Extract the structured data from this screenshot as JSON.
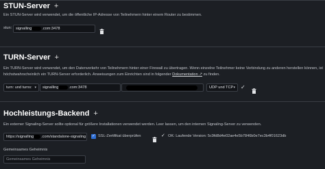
{
  "stun": {
    "title": "STUN-Server",
    "add_label": "+",
    "description": "Ein STUN-Server wird verwendet, um die öffentliche IP-Adresse von Teilnehmern hinter einem Router zu bestimmen.",
    "field_label": "stun:",
    "field_value_prefix": "signalling",
    "field_value_suffix": ".com:3478"
  },
  "turn": {
    "title": "TURN-Server",
    "add_label": "+",
    "description_part1": "Ein TURN-Server wird verwendet, um den Datenverkehr von Teilnehmern hinter einer Firewall zu übertragen. Wenn einzelne Teilnehmer keine Verbindung zu anderen herstellen können, ist höchstwahrscheinlich ein TURN-Server erforderlich. Anweisungen zum Einrichten sind in folgender",
    "description_link": "Dokumentation ↗",
    "description_part2": "zu finden.",
    "scheme_select": "turn: und turns:",
    "server_prefix": "signalling",
    "server_suffix": ".com:3478",
    "protocol_select": "UDP und TCP"
  },
  "hpb": {
    "title": "Hochleistungs-Backend",
    "add_label": "+",
    "description": "Ein externer Signaling-Server sollte optional für größere Installationen verwendet werden. Leer lassen, um den internen Signaling-Server zu verwenden.",
    "url_prefix": "https://signalling",
    "url_suffix": ".com/standalone-signaling",
    "ssl_label": "SSL-Zertifikat überprüfen",
    "status_label": "OK: Laufende Version: 5c9fd8d4e02ae4e5b7846b0e7ec3b4f01623db",
    "secret_label": "Gemeinsames Geheimnis",
    "secret_placeholder": "Gemeinsames Geheimnis"
  },
  "icons": {
    "trash": "trash-icon",
    "check": "checkmark-icon",
    "ok": "checkmark-icon",
    "caret": "chevron-down-icon"
  },
  "colors": {
    "background": "#1c1f24",
    "accent": "#2f6fd6",
    "input_background": "#121418"
  }
}
